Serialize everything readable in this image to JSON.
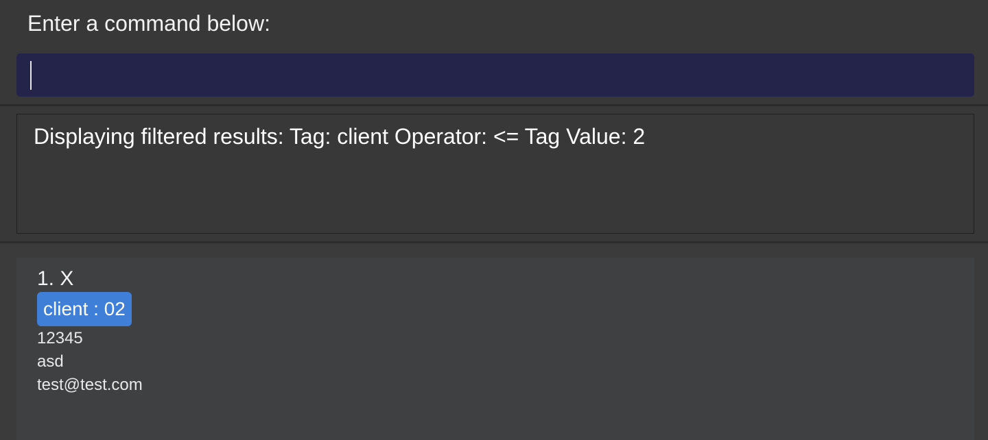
{
  "command": {
    "prompt": "Enter a command below:",
    "input_value": "",
    "input_placeholder": ""
  },
  "result": {
    "message": "Displaying filtered results: Tag: client Operator: <= Tag Value: 2"
  },
  "person_list": {
    "items": [
      {
        "index_name": "1. X",
        "tags": [
          {
            "label": "client : 02"
          }
        ],
        "phone": "12345",
        "address": "asd",
        "email": "test@test.com"
      }
    ]
  },
  "colors": {
    "command_box_bg": "#24234a",
    "tag_bg": "#3f7fd8",
    "panel_bg": "#383838",
    "card_bg": "#3f4042"
  }
}
